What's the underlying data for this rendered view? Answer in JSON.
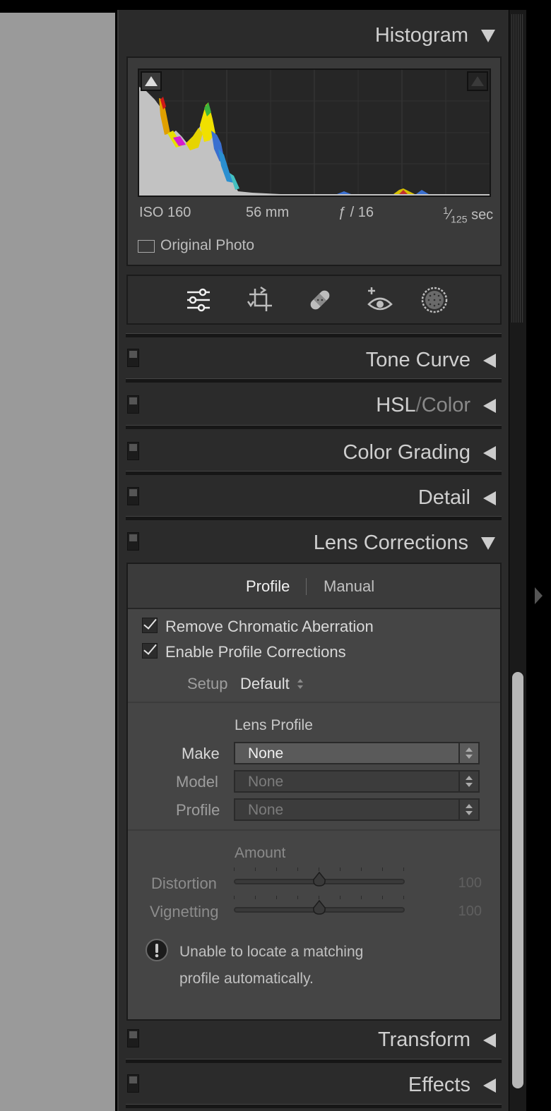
{
  "colors": {
    "panel_bg": "#2b2b2b",
    "canvas_bg": "#9a9a9a",
    "box_bg": "#3a3a3a",
    "text": "#cfcfcf"
  },
  "histogram": {
    "title": "Histogram",
    "iso": "ISO 160",
    "focal": "56 mm",
    "aperture": "ƒ / 16",
    "shutter_num": "1",
    "shutter_den": "125",
    "shutter_unit": "sec",
    "original_photo": "Original Photo"
  },
  "tools": [
    "edit-sliders-icon",
    "crop-icon",
    "healing-bandage-icon",
    "red-eye-icon",
    "masking-icon"
  ],
  "sections": {
    "tone_curve": "Tone Curve",
    "hsl_primary": "HSL",
    "hsl_sep": "/",
    "hsl_secondary": "Color",
    "color_grading": "Color Grading",
    "detail": "Detail",
    "lens_corrections": "Lens Corrections",
    "transform": "Transform",
    "effects": "Effects"
  },
  "lens": {
    "tab_profile": "Profile",
    "tab_manual": "Manual",
    "remove_ca": "Remove Chromatic Aberration",
    "enable_profile": "Enable Profile Corrections",
    "setup_label": "Setup",
    "setup_value": "Default",
    "lens_profile_heading": "Lens Profile",
    "make_label": "Make",
    "make_value": "None",
    "model_label": "Model",
    "model_value": "None",
    "profile_label": "Profile",
    "profile_value": "None",
    "amount_heading": "Amount",
    "distortion_label": "Distortion",
    "distortion_value": "100",
    "vignetting_label": "Vignetting",
    "vignetting_value": "100",
    "warning_line1": "Unable to locate a matching",
    "warning_line2": "profile automatically."
  }
}
